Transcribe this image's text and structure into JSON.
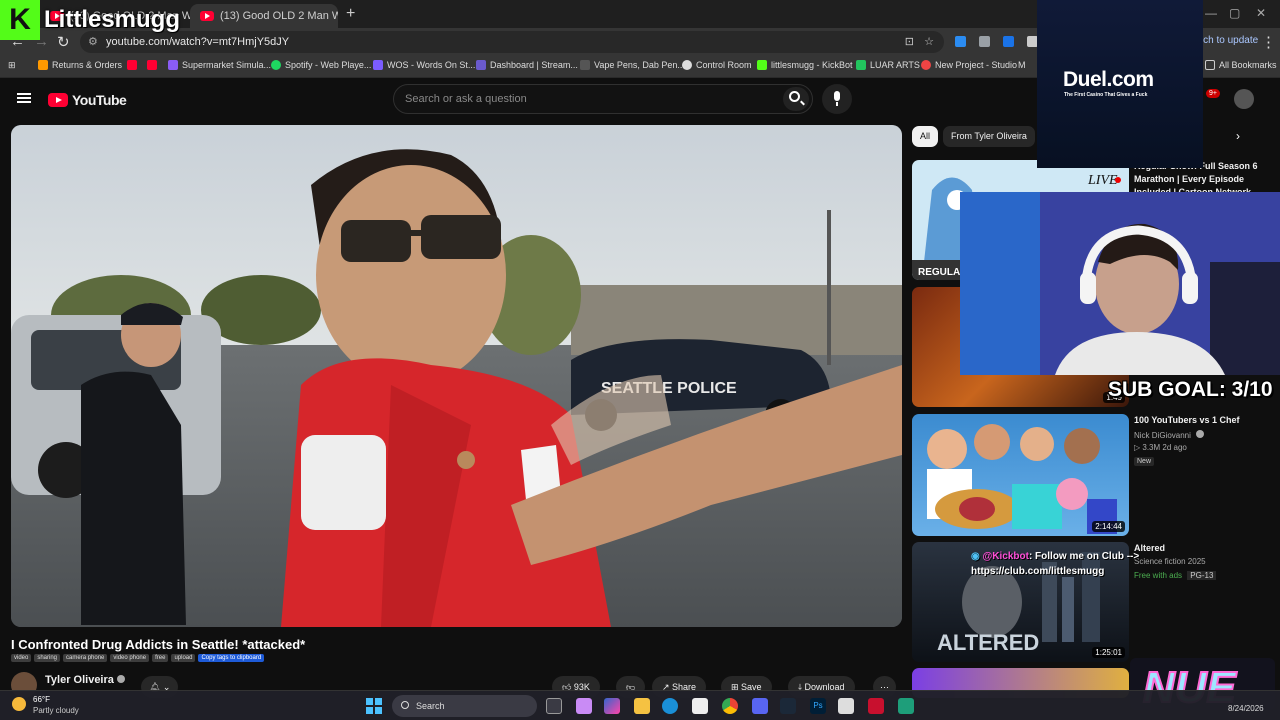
{
  "browser": {
    "tabs": [
      {
        "label": "(13) Good OLD 2 Man W/ ..."
      },
      {
        "label": "(13)  Good OLD 2 Man W/ G..."
      }
    ],
    "new_tab": "+",
    "url": "youtube.com/watch?v=mt7HmjY5dJY",
    "relaunch_label": "anch to update",
    "bookmarks": [
      {
        "label": "Returns & Orders",
        "color": "#ff9900"
      },
      {
        "label": "",
        "color": "#ff0033"
      },
      {
        "label": "",
        "color": "#ff0033"
      },
      {
        "label": "Supermarket Simula...",
        "color": "#8a5cf6"
      },
      {
        "label": "Spotify - Web Playe...",
        "color": "#1ed760"
      },
      {
        "label": "WOS - Words On St...",
        "color": "#7b5cff"
      },
      {
        "label": "Dashboard | Stream...",
        "color": "#6a5acd"
      },
      {
        "label": "Vape Pens, Dab Pen...",
        "color": "#555555"
      },
      {
        "label": "Control Room",
        "color": "#dddddd"
      },
      {
        "label": "littlesmugg - KickBot",
        "color": "#53fc18"
      },
      {
        "label": "LUAR ARTS",
        "color": "#22c55e"
      },
      {
        "label": "New Project - Studio",
        "color": "#ef4444"
      },
      {
        "label": "M",
        "color": "#f59e0b"
      }
    ],
    "all_bookmarks": "All Bookmarks"
  },
  "youtube": {
    "logo": "YouTube",
    "search_placeholder": "Search or ask a question",
    "notifications": "9+",
    "video": {
      "title": "I Confronted Drug Addicts in Seattle! *attacked*",
      "tags": [
        "video",
        "sharing",
        "camera phone",
        "video phone",
        "free",
        "upload"
      ],
      "copy_tags": "Copy tags to clipboard",
      "channel": "Tyler Oliveira",
      "likes": "93K",
      "share": "Share",
      "save": "Save",
      "download": "Download",
      "police_text": "SEATTLE POLICE"
    },
    "chips": [
      {
        "label": "All",
        "active": true
      },
      {
        "label": "From Tyler Oliveira",
        "active": false
      }
    ],
    "recommendations": [
      {
        "title": "Regular Show: Full Season 6 Marathon | Every Episode Included | Cartoon Network",
        "live_badge": "LIVE",
        "thumb_label": "REGULAR"
      },
      {
        "title": "",
        "duration": "1:49"
      },
      {
        "title": "100 YouTubers vs 1 Chef",
        "channel": "Nick DiGiovanni",
        "meta": "3.3M  2d ago",
        "badge": "New",
        "duration": "2:14:44"
      },
      {
        "title": "Altered",
        "meta": "Science fiction 2025",
        "meta2": "Free with ads",
        "rating": "PG-13",
        "duration": "1:25:01",
        "thumb_label": "ALTERED"
      }
    ]
  },
  "overlay": {
    "kick_letter": "K",
    "streamer": "Littlesmugg",
    "sponsor": "Duel.com",
    "sponsor_tagline": "The First Casino That Gives a Fuck",
    "sub_goal": "SUB GOAL: 3/10",
    "chat": {
      "user": "@Kickbot",
      "message": ": Follow me on Club -->",
      "link": "https://club.com/littlesmugg"
    },
    "corner_logo": "NUE"
  },
  "taskbar": {
    "temp": "66°F",
    "condition": "Partly cloudy",
    "search": "Search",
    "date": "8/24/2026"
  }
}
